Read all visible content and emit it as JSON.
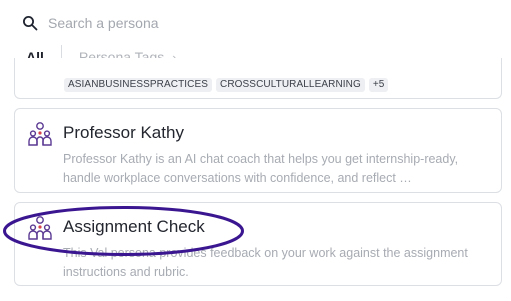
{
  "search": {
    "placeholder": "Search a persona",
    "icon": "search-icon"
  },
  "tabs": {
    "all_label": "All",
    "persona_tags_label": "Persona Tags",
    "chevron": "›"
  },
  "top_card": {
    "tags": [
      "ASIANBUSINESSPRACTICES",
      "CROSSCULTURALLEARNING",
      "+5"
    ]
  },
  "personas": [
    {
      "title": "Professor Kathy",
      "description": "Professor Kathy is an AI chat coach that helps you get internship-ready, handle workplace conversations with confidence, and reflect …",
      "icon": "persona-group-icon"
    },
    {
      "title": "Assignment Check",
      "description": "This Val persona provides feedback on your work against the assignment instructions and rubric.",
      "icon": "persona-group-icon"
    }
  ],
  "colors": {
    "highlight_ring": "#3b1691",
    "icon_purple": "#5b3a93",
    "icon_red": "#d8434b"
  }
}
